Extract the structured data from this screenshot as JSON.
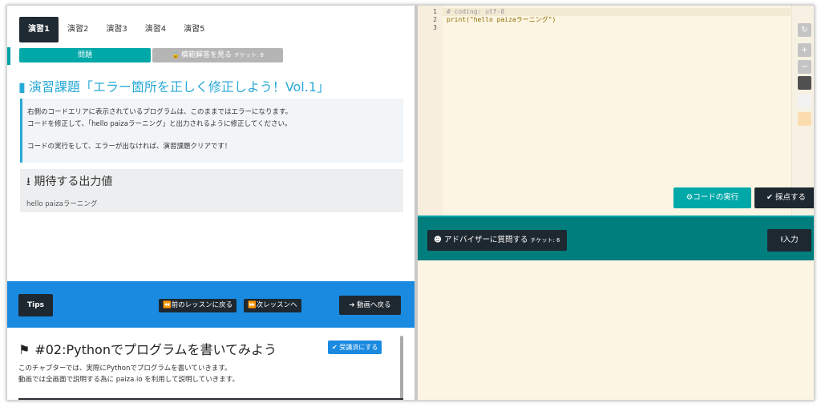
{
  "tabs": [
    "演習1",
    "演習2",
    "演習3",
    "演習4",
    "演習5"
  ],
  "subtabs": {
    "problem": "問題",
    "answer": "模範解答を見る",
    "answer_ticket": "チケット: 8"
  },
  "task": {
    "title": "演習課題「エラー箇所を正しく修正しよう！Vol.1」",
    "desc_line1": "右側のコードエリアに表示されているプログラムは、このままではエラーになります。",
    "desc_line2": "コードを修正して、「hello paizaラーニング」と出力されるように修正してください。",
    "desc_line3": "コードの実行をして、エラーが出なければ、演習課題クリアです！"
  },
  "expected": {
    "heading": "期待する出力値",
    "value": "hello paizaラーニング"
  },
  "tips": {
    "label": "Tips",
    "prev": "前のレッスンに戻る",
    "next": "次レッスンへ",
    "video": "動画へ戻る"
  },
  "chapter": {
    "title": "#02:Pythonでプログラムを書いてみよう",
    "done_button": "受講済にする",
    "desc_line1": "このチャプターでは、実際にPythonでプログラムを書いていきます。",
    "desc_line2": "動画では全画面で説明する為に paiza.io を利用して説明していきます。"
  },
  "editor": {
    "line_numbers": [
      "1",
      "2",
      "3"
    ],
    "line1": "# coding: utf-8",
    "line2_fn": "print",
    "line2_rest": "(\"hello paizaラーニング\")"
  },
  "buttons": {
    "run": "コードの実行",
    "score": "採点する",
    "advisor": "アドバイザーに質問する",
    "advisor_ticket": "チケット: 6",
    "input": "入力"
  },
  "colors": {
    "teal": "#00a8a8",
    "dark": "#1e2830",
    "blue": "#1a8ae0",
    "title_blue": "#29a9d6",
    "editor_bg": "#fdf5e3"
  }
}
